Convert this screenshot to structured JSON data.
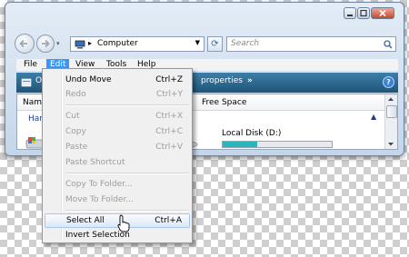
{
  "address": {
    "icon": "computer-icon",
    "separator": "▸",
    "path": "Computer"
  },
  "search": {
    "placeholder": "Search"
  },
  "menubar": {
    "file": "File",
    "edit": "Edit",
    "view": "View",
    "tools": "Tools",
    "help": "Help"
  },
  "commandbar": {
    "left_fragment": "O",
    "properties": "properties",
    "more": "»",
    "help_glyph": "?"
  },
  "columns": {
    "name": "Name",
    "free_space": "Free Space"
  },
  "content": {
    "group_header": "Hard",
    "drive_label": "Local Disk (D:)",
    "drive_fill": 0.32
  },
  "edit_menu": {
    "items": [
      {
        "label": "Undo Move",
        "shortcut": "Ctrl+Z",
        "enabled": true
      },
      {
        "label": "Redo",
        "shortcut": "Ctrl+Y",
        "enabled": false
      },
      {
        "label": "Cut",
        "shortcut": "Ctrl+X",
        "enabled": false
      },
      {
        "label": "Copy",
        "shortcut": "Ctrl+C",
        "enabled": false
      },
      {
        "label": "Paste",
        "shortcut": "Ctrl+V",
        "enabled": false
      },
      {
        "label": "Paste Shortcut",
        "shortcut": "",
        "enabled": false
      },
      {
        "label": "Copy To Folder...",
        "shortcut": "",
        "enabled": false
      },
      {
        "label": "Move To Folder...",
        "shortcut": "",
        "enabled": false
      },
      {
        "label": "Select All",
        "shortcut": "Ctrl+A",
        "enabled": true,
        "highlighted": true
      },
      {
        "label": "Invert Selection",
        "shortcut": "",
        "enabled": true
      }
    ]
  },
  "colors": {
    "menu_highlight": "#3399ff",
    "command_bar": "#2a6a92",
    "drive_bar": "#2bb3c0"
  }
}
